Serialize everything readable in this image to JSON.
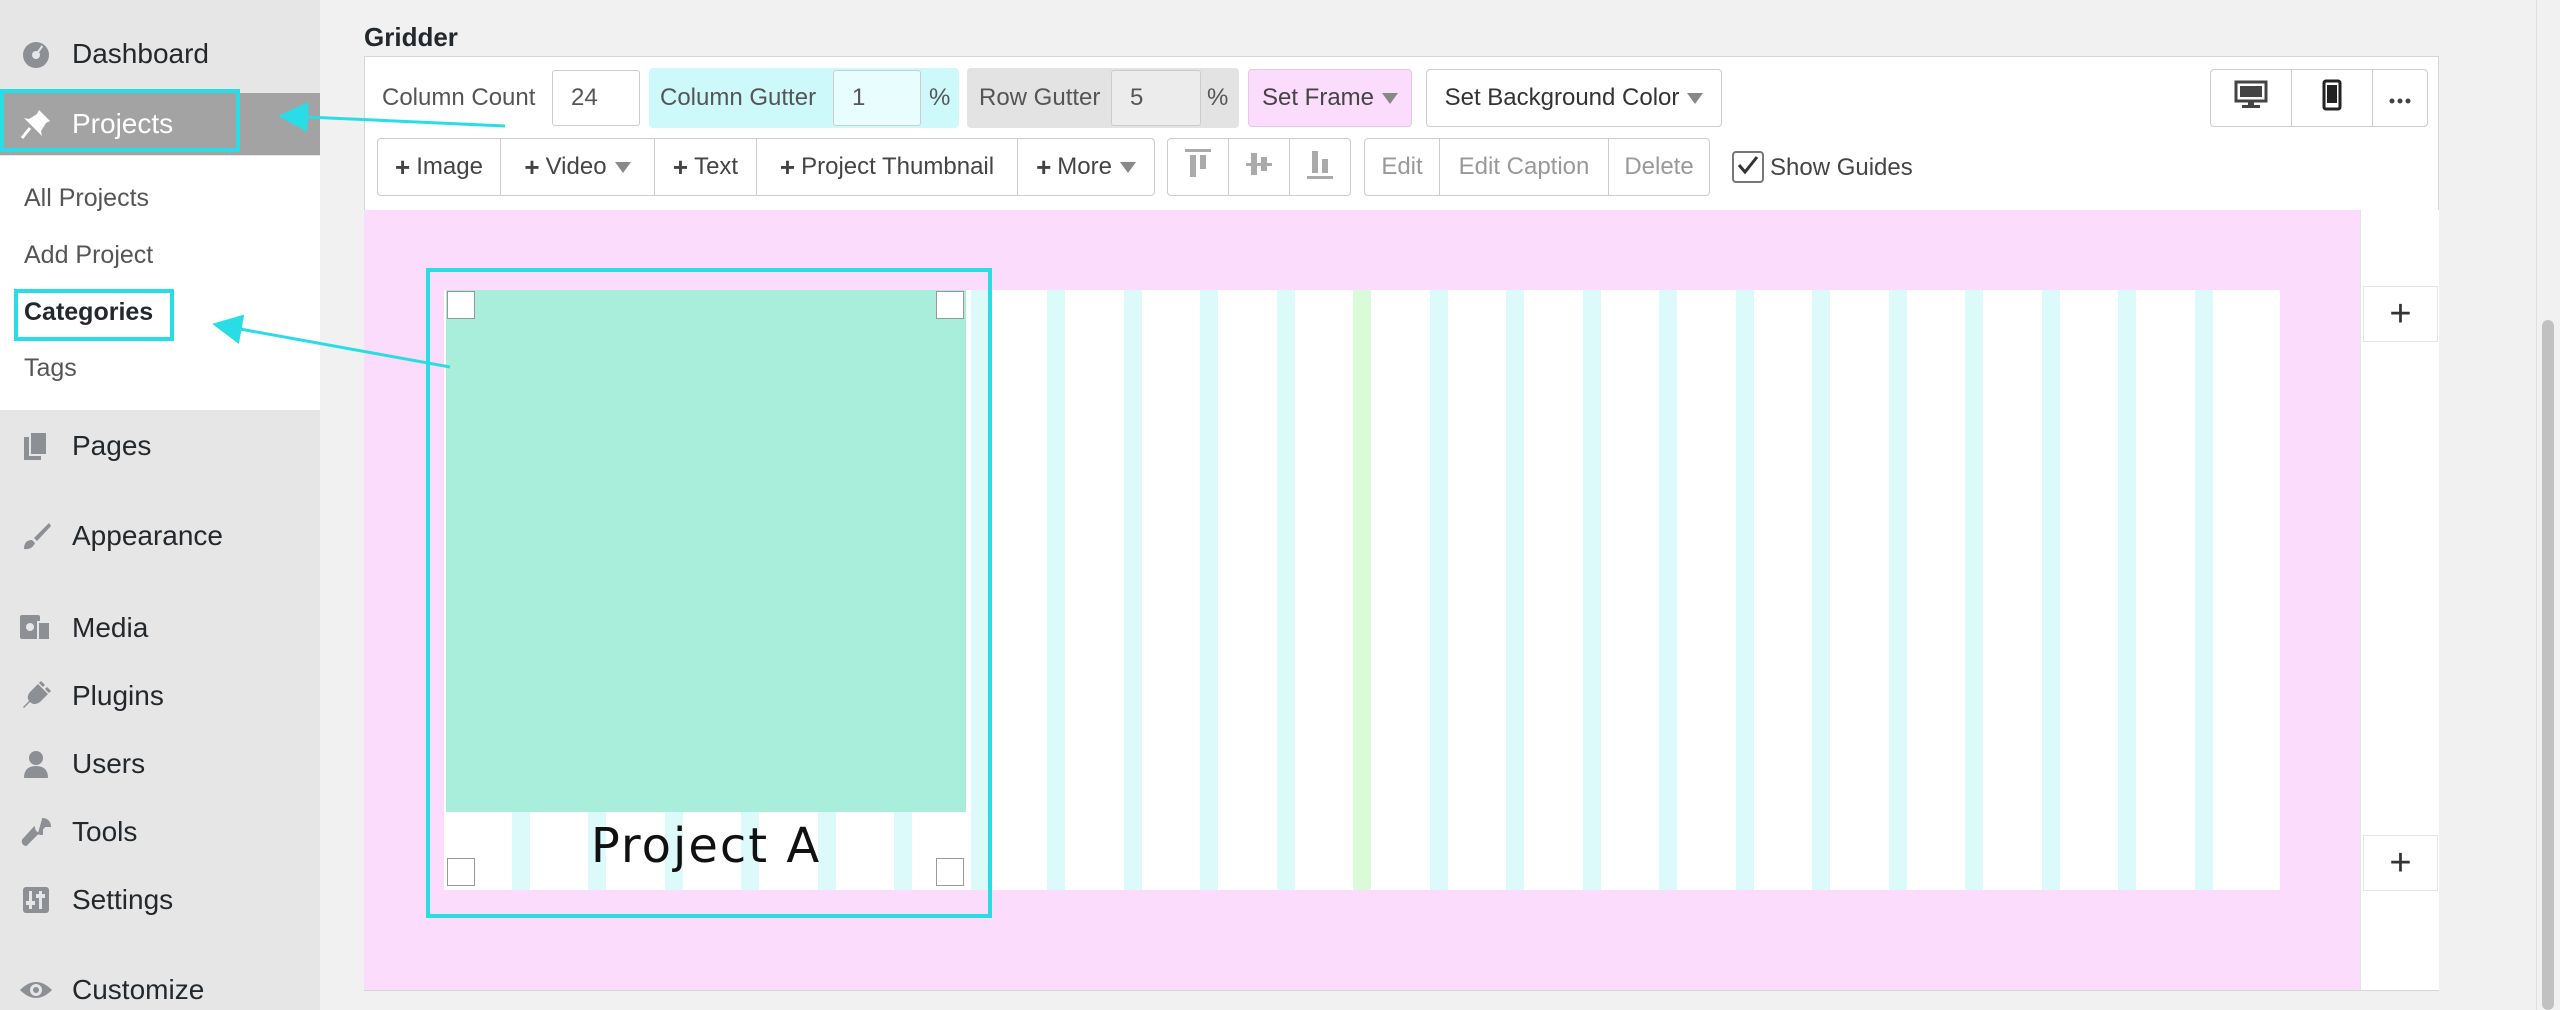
{
  "sidebar": {
    "items": [
      {
        "id": "dashboard",
        "label": "Dashboard",
        "icon": "dashboard-icon"
      },
      {
        "id": "projects",
        "label": "Projects",
        "icon": "pushpin-icon"
      },
      {
        "id": "pages",
        "label": "Pages",
        "icon": "pages-icon"
      },
      {
        "id": "appearance",
        "label": "Appearance",
        "icon": "paintbrush-icon"
      },
      {
        "id": "media",
        "label": "Media",
        "icon": "media-icon"
      },
      {
        "id": "plugins",
        "label": "Plugins",
        "icon": "plug-icon"
      },
      {
        "id": "users",
        "label": "Users",
        "icon": "user-icon"
      },
      {
        "id": "tools",
        "label": "Tools",
        "icon": "wrench-icon"
      },
      {
        "id": "settings",
        "label": "Settings",
        "icon": "settings-icon"
      },
      {
        "id": "customize",
        "label": "Customize",
        "icon": "eye-icon"
      }
    ],
    "submenu": [
      "All Projects",
      "Add Project",
      "Categories",
      "Tags"
    ]
  },
  "gridder": {
    "title": "Gridder",
    "column_count_label": "Column Count",
    "column_count_value": "24",
    "column_gutter_label": "Column Gutter",
    "column_gutter_value": "1",
    "row_gutter_label": "Row Gutter",
    "row_gutter_value": "5",
    "percent": "%",
    "set_frame": "Set Frame",
    "set_background_color": "Set Background Color",
    "add_image": "Image",
    "add_video": "Video",
    "add_text": "Text",
    "add_project_thumbnail": "Project Thumbnail",
    "more": "More",
    "edit": "Edit",
    "edit_caption": "Edit Caption",
    "delete": "Delete",
    "show_guides": "Show Guides",
    "item_caption": "Project A"
  },
  "colors": {
    "highlight": "#29dde6",
    "canvas_bg": "#fcdcfc",
    "item_fill": "#a8eedb",
    "gutter_guide": "#dcfafa",
    "active_column": "#dafbd9"
  }
}
